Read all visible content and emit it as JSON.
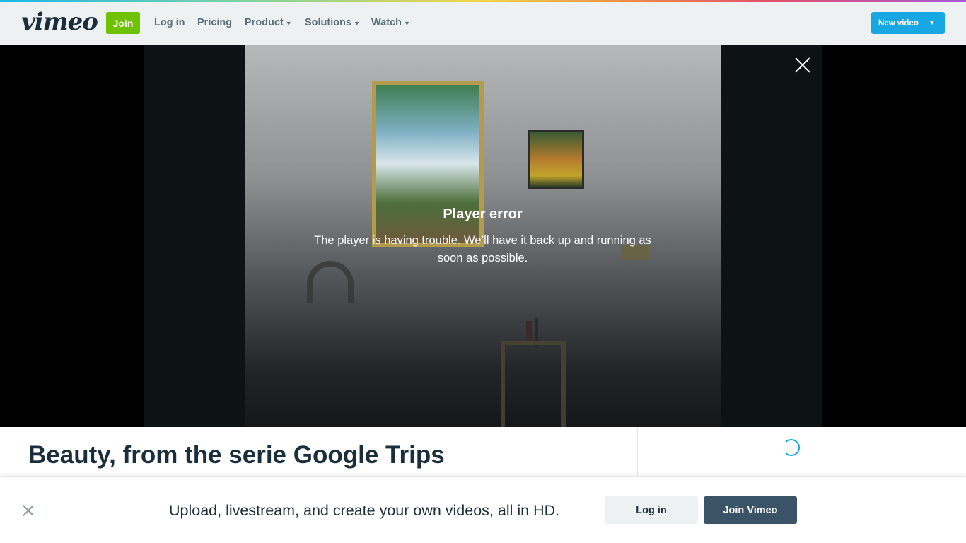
{
  "header": {
    "logo": "vimeo",
    "join_label": "Join",
    "nav": {
      "login": "Log in",
      "pricing": "Pricing",
      "product": "Product",
      "solutions": "Solutions",
      "watch": "Watch"
    },
    "new_video_label": "New video"
  },
  "player": {
    "error_title": "Player error",
    "error_message": "The player is having trouble. We’ll have it back up and running as soon as possible."
  },
  "video": {
    "title": "Beauty, from the serie Google Trips"
  },
  "promo_bar": {
    "message": "Upload, livestream, and create your own videos, all in HD.",
    "login_label": "Log in",
    "join_label": "Join Vimeo"
  },
  "colors": {
    "accent": "#17a8e3",
    "join_green": "#6ec200",
    "dark_button": "#3a5366"
  }
}
